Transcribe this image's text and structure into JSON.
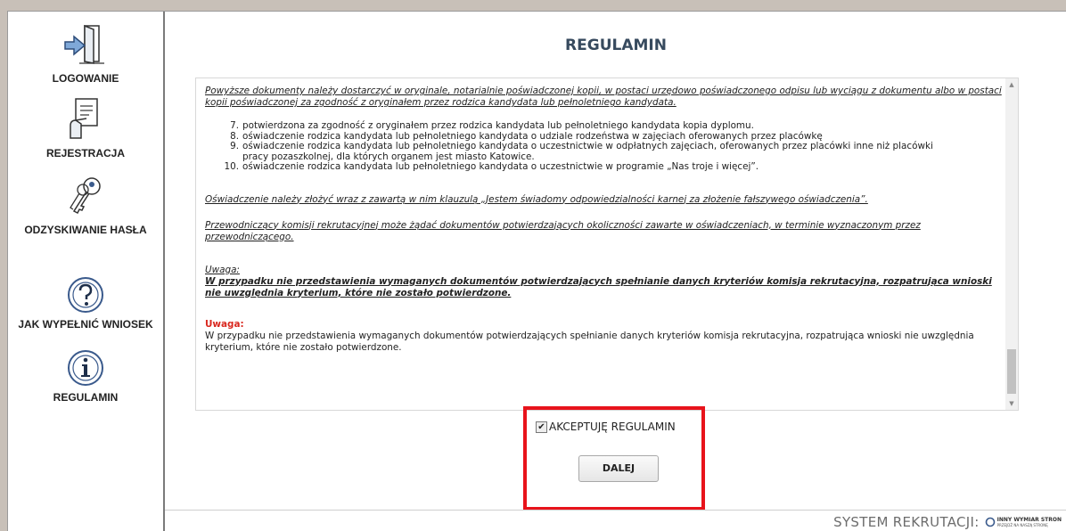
{
  "sidebar": {
    "items": [
      {
        "label": "LOGOWANIE",
        "icon": "login-door-icon"
      },
      {
        "label": "REJESTRACJA",
        "icon": "registration-form-icon"
      },
      {
        "label": "ODZYSKIWANIE HASŁA",
        "icon": "keys-icon"
      },
      {
        "label": "JAK WYPEŁNIĆ WNIOSEK",
        "icon": "question-circle-icon"
      },
      {
        "label": "REGULAMIN",
        "icon": "info-circle-icon"
      }
    ]
  },
  "main": {
    "title": "REGULAMIN",
    "content": {
      "intro": "Powyższe dokumenty należy dostarczyć w oryginale, notarialnie poświadczonej kopii, w postaci urzędowo poświadczonego odpisu lub wyciągu z dokumentu albo w postaci kopii poświadczonej za zgodność z oryginałem przez rodzica kandydata lub pełnoletniego kandydata.",
      "list": [
        {
          "num": "7.",
          "text": "potwierdzona za zgodność z oryginałem przez rodzica kandydata lub pełnoletniego kandydata kopia dyplomu."
        },
        {
          "num": "8.",
          "text": "oświadczenie rodzica kandydata lub pełnoletniego kandydata o udziale rodzeństwa w zajęciach oferowanych przez placówkę"
        },
        {
          "num": "9.",
          "text": "oświadczenie rodzica kandydata lub pełnoletniego kandydata o uczestnictwie w odpłatnych zajęciach, oferowanych przez placówki inne niż placówki",
          "cont": "pracy pozaszkolnej, dla których organem jest miasto Katowice."
        },
        {
          "num": "10.",
          "text": "oświadczenie rodzica kandydata lub pełnoletniego kandydata o uczestnictwie w programie „Nas troje i więcej”."
        }
      ],
      "clause": "Oświadczenie należy złożyć wraz z zawartą w nim klauzulą „Jestem świadomy odpowiedzialności karnej za złożenie  fałszywego oświadczenia”.",
      "chairman": "Przewodniczący komisji rekrutacyjnej może żądać dokumentów potwierdzających okoliczności zawarte w oświadczeniach, w terminie wyznaczonym przez przewodniczącego.",
      "note1_heading": "Uwaga:",
      "note1_text": "W przypadku nie przedstawienia wymaganych dokumentów potwierdzających spełnianie danych kryteriów komisja rekrutacyjna, rozpatrująca wnioski nie uwzględnia kryterium, które nie zostało potwierdzone.",
      "note2_heading": "Uwaga:",
      "note2_text": "W przypadku nie przedstawienia wymaganych dokumentów potwierdzających spełnianie danych kryteriów komisja rekrutacyjna, rozpatrująca wnioski nie uwzględnia kryterium, które nie zostało potwierdzone."
    },
    "accept_label": "AKCEPTUJĘ REGULAMIN",
    "accept_checked": true,
    "next_button": "DALEJ"
  },
  "footer": {
    "system_label": "SYSTEM REKRUTACJI:",
    "logo_line1": "INNY WYMIAR STRON",
    "logo_line2": "PRZEJDŹ NA NASZĄ STRONĘ"
  },
  "colors": {
    "title": "#374a5e",
    "warning_red": "#d9281f",
    "highlight_box": "#e8131b",
    "icon_blue": "#3a5a8c"
  }
}
